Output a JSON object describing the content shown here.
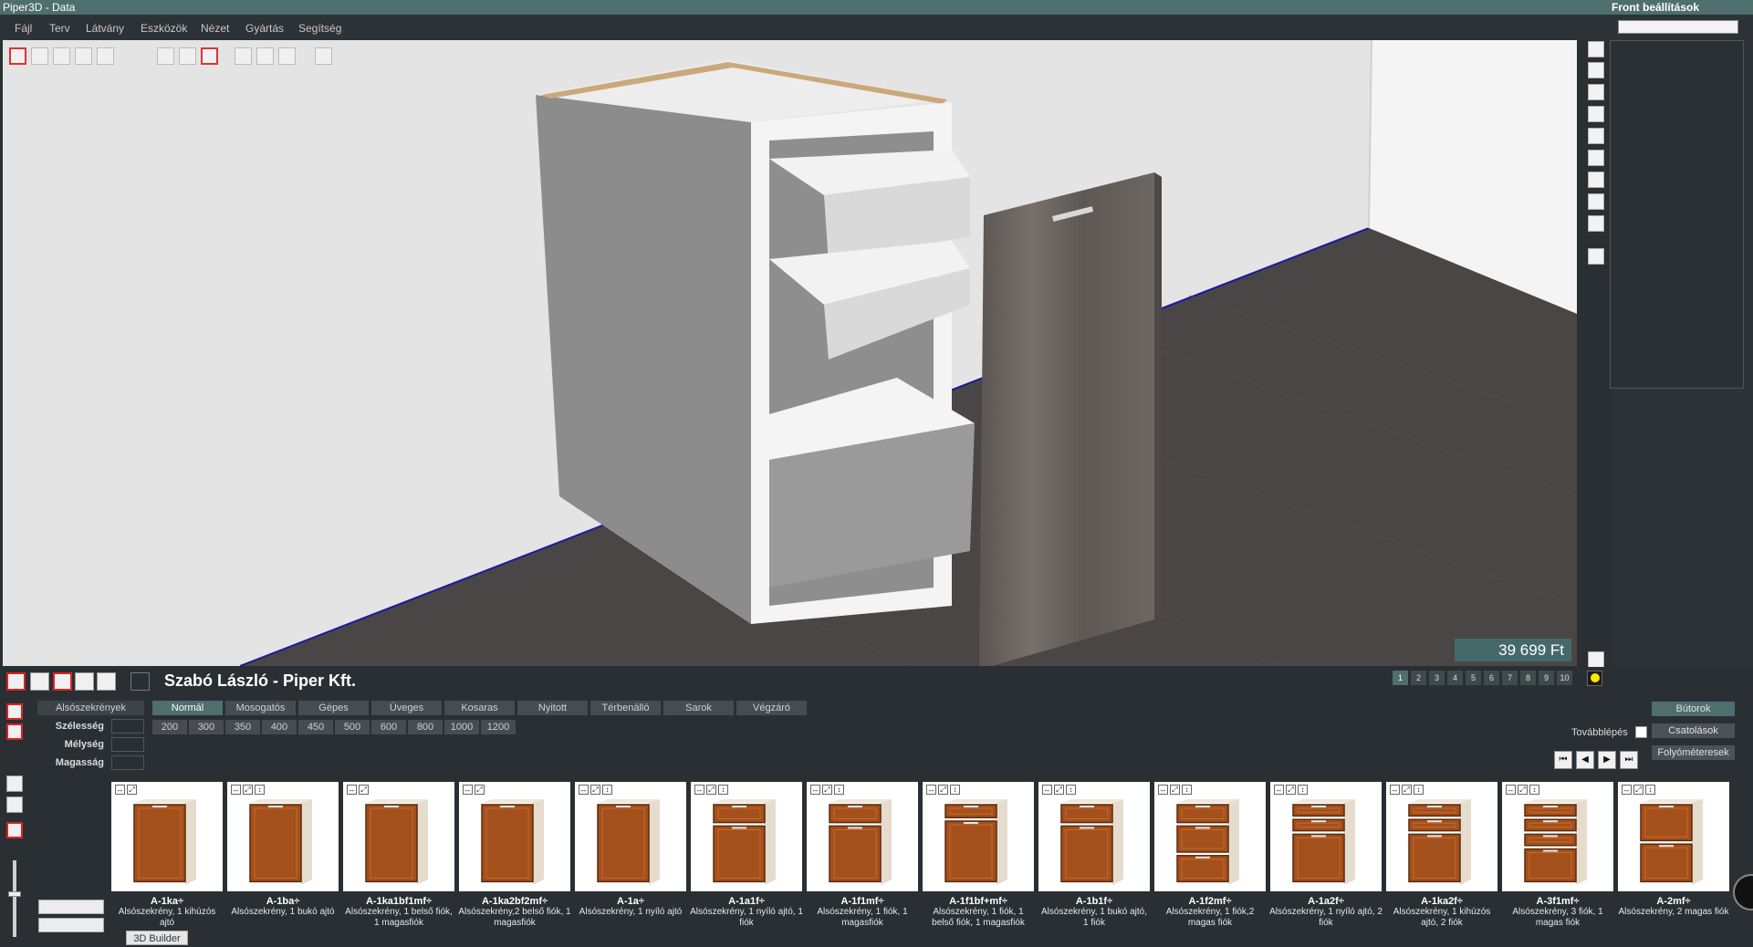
{
  "title_bar": {
    "app_title": "Piper3D - Data",
    "right_panel_title": "Front beállítások"
  },
  "menu": [
    "Fájl",
    "Terv",
    "Látvány",
    "Eszközök",
    "Nézet",
    "Gyártás",
    "Segítség"
  ],
  "viewport": {
    "price": "39 699 Ft"
  },
  "client": {
    "name": "Szabó László - Piper Kft."
  },
  "page_numbers": [
    "1",
    "2",
    "3",
    "4",
    "5",
    "6",
    "7",
    "8",
    "9",
    "10"
  ],
  "category": {
    "label": "Alsószekrények"
  },
  "type_tabs": [
    "Normál",
    "Mosogatós",
    "Gépes",
    "Üveges",
    "Kosaras",
    "Nyitott",
    "Térbenálló",
    "Sarok",
    "Végzáró"
  ],
  "widths": [
    "200",
    "300",
    "350",
    "400",
    "450",
    "500",
    "600",
    "800",
    "1000",
    "1200"
  ],
  "dims": {
    "width_label": "Szélesség",
    "depth_label": "Mélység",
    "height_label": "Magasság"
  },
  "right_buttons": {
    "furniture": "Bútorok",
    "attachments": "Csatolások",
    "running_meter": "Folyóméteresek",
    "continue_label": "Továbblépés"
  },
  "builder_tooltip": "3D Builder",
  "catalog": [
    {
      "code": "A-1ka÷",
      "desc": "Alsószekrény, 1 kihúzós ajtó",
      "icons": "↔⤢"
    },
    {
      "code": "A-1ba÷",
      "desc": "Alsószekrény, 1 bukó ajtó",
      "icons": "↔⤢↕"
    },
    {
      "code": "A-1ka1bf1mf÷",
      "desc": "Alsószekrény, 1 belső fiók, 1 magasfiók",
      "icons": "↔⤢"
    },
    {
      "code": "A-1ka2bf2mf÷",
      "desc": "Alsószekrény,2 belső fiók, 1 magasfiók",
      "icons": "↔⤢"
    },
    {
      "code": "A-1a÷",
      "desc": "Alsószekrény, 1 nyíló ajtó",
      "icons": "↔⤢↕"
    },
    {
      "code": "A-1a1f÷",
      "desc": "Alsószekrény, 1 nyíló ajtó, 1 fiók",
      "icons": "↔⤢↕"
    },
    {
      "code": "A-1f1mf÷",
      "desc": "Alsószekrény, 1 fiók, 1 magasfiók",
      "icons": "↔⤢↕"
    },
    {
      "code": "A-1f1bf+mf÷",
      "desc": "Alsószekrény, 1 fiók, 1 belső fiók, 1 magasfiók",
      "icons": "↔⤢↕"
    },
    {
      "code": "A-1b1f÷",
      "desc": "Alsószekrény, 1 bukó ajtó, 1 fiók",
      "icons": "↔⤢↕"
    },
    {
      "code": "A-1f2mf÷",
      "desc": "Alsószekrény, 1 fiók,2 magas fiók",
      "icons": "↔⤢↕"
    },
    {
      "code": "A-1a2f÷",
      "desc": "Alsószekrény, 1 nyíló ajtó, 2 fiók",
      "icons": "↔⤢↕"
    },
    {
      "code": "A-1ka2f÷",
      "desc": "Alsószekrény, 1 kihúzós ajtó, 2 fiók",
      "icons": "↔⤢↕"
    },
    {
      "code": "A-3f1mf÷",
      "desc": "Alsószekrény, 3 fiók, 1 magas fiók",
      "icons": "↔⤢↕"
    },
    {
      "code": "A-2mf÷",
      "desc": "Alsószekrény, 2 magas fiók",
      "icons": "↔⤢↕"
    }
  ]
}
